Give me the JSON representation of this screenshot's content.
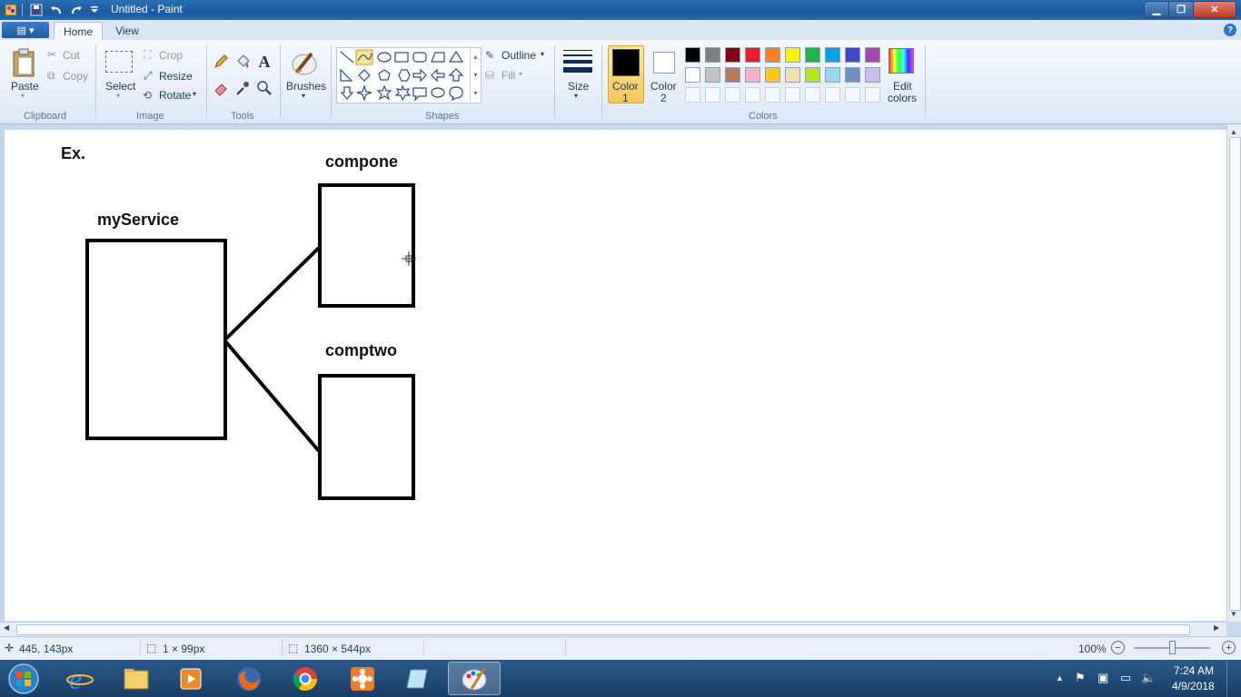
{
  "window": {
    "title": "Untitled - Paint",
    "quick_access": [
      "save-icon",
      "undo-icon",
      "redo-icon",
      "customize-dropdown-icon"
    ],
    "controls": [
      "minimize",
      "maximize",
      "close"
    ]
  },
  "ribbon": {
    "tabs": [
      "Home",
      "View"
    ],
    "active_tab": "Home",
    "clipboard": {
      "group_label": "Clipboard",
      "paste": "Paste",
      "cut": "Cut",
      "copy": "Copy"
    },
    "image": {
      "group_label": "Image",
      "select": "Select",
      "crop": "Crop",
      "resize": "Resize",
      "rotate": "Rotate"
    },
    "tools": {
      "group_label": "Tools",
      "items": [
        "pencil-icon",
        "fill-icon",
        "text-icon",
        "eraser-icon",
        "color-picker-icon",
        "magnifier-icon"
      ]
    },
    "brushes": {
      "label": "Brushes"
    },
    "shapes": {
      "group_label": "Shapes",
      "outline": "Outline",
      "fill": "Fill"
    },
    "size": {
      "label": "Size"
    },
    "colors": {
      "group_label": "Colors",
      "color1_label_line1": "Color",
      "color1_label_line2": "1",
      "color2_label_line1": "Color",
      "color2_label_line2": "2",
      "color1_value": "#000000",
      "color2_value": "#ffffff",
      "edit_line1": "Edit",
      "edit_line2": "colors",
      "palette_row1": [
        "#000000",
        "#7f7f7f",
        "#880015",
        "#ed1c24",
        "#ff7f27",
        "#fff200",
        "#22b14c",
        "#00a2e8",
        "#3f48cc",
        "#a349a4"
      ],
      "palette_row2": [
        "#ffffff",
        "#c3c3c3",
        "#b97a57",
        "#ffaec9",
        "#ffc90e",
        "#efe4b0",
        "#b5e61d",
        "#99d9ea",
        "#7092be",
        "#c8bfe7"
      ]
    }
  },
  "canvas": {
    "labels": {
      "ex": "Ex.",
      "service": "myService",
      "comp1": "compone",
      "comp2": "comptwo"
    }
  },
  "status": {
    "cursor_pos": "445, 143px",
    "selection_size": "1 × 99px",
    "image_size": "1360 × 544px",
    "zoom": "100%"
  },
  "taskbar": {
    "apps": [
      "windows-start-icon",
      "internet-explorer-icon",
      "file-explorer-icon",
      "media-player-icon",
      "firefox-icon",
      "chrome-icon",
      "app-flower-icon",
      "notepad-icon",
      "paint-icon"
    ],
    "time": "7:24 AM",
    "date": "4/9/2018"
  }
}
